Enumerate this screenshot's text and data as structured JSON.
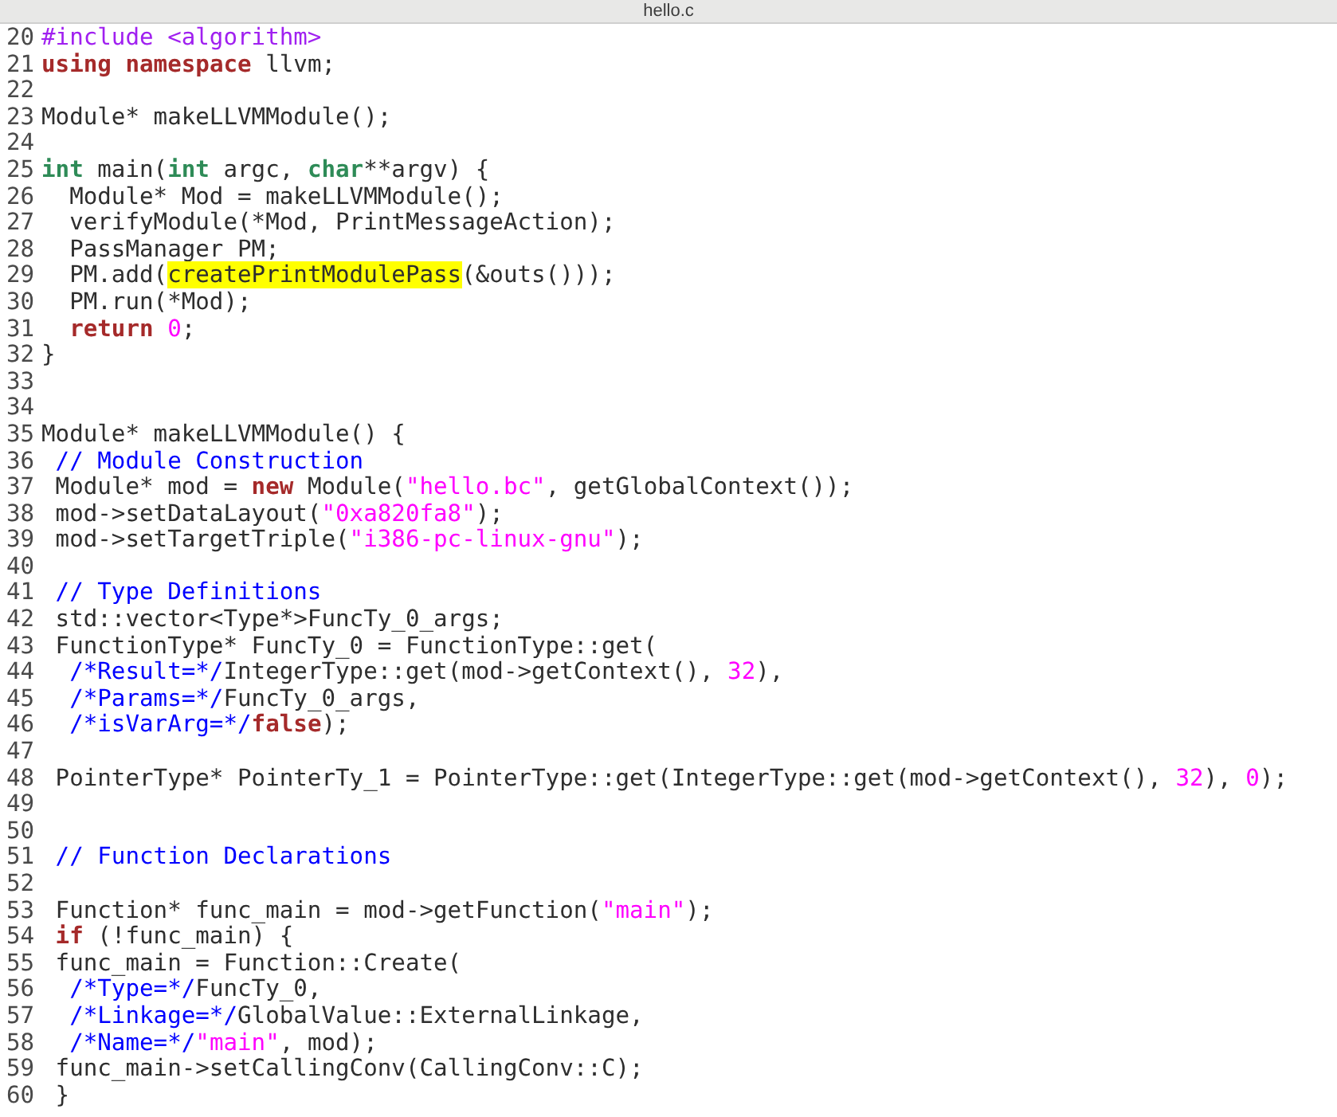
{
  "window": {
    "title": "hello.c"
  },
  "editor": {
    "lines": [
      {
        "number": "20",
        "tokens": [
          {
            "kind": "preproc",
            "text": "#include <algorithm>"
          }
        ]
      },
      {
        "number": "21",
        "tokens": [
          {
            "kind": "keyword",
            "text": "using"
          },
          {
            "kind": "keyword",
            "text": " namespace"
          },
          {
            "kind": "plain",
            "text": " llvm;"
          }
        ]
      },
      {
        "number": "22"
      },
      {
        "number": "23",
        "tokens": [
          {
            "kind": "plain",
            "text": "Module* makeLLVMModule();"
          }
        ]
      },
      {
        "number": "24"
      },
      {
        "number": "25",
        "tokens": [
          {
            "kind": "type",
            "text": "int"
          },
          {
            "kind": "plain",
            "text": " main("
          },
          {
            "kind": "type",
            "text": "int"
          },
          {
            "kind": "plain",
            "text": " argc, "
          },
          {
            "kind": "type",
            "text": "char"
          },
          {
            "kind": "plain",
            "text": "**argv) {"
          }
        ]
      },
      {
        "number": "26",
        "tokens": [
          {
            "kind": "plain",
            "text": "  Module* Mod = makeLLVMModule();"
          }
        ]
      },
      {
        "number": "27",
        "tokens": [
          {
            "kind": "plain",
            "text": "  verifyModule(*Mod, PrintMessageAction);"
          }
        ]
      },
      {
        "number": "28",
        "tokens": [
          {
            "kind": "plain",
            "text": "  PassManager PM;"
          }
        ]
      },
      {
        "number": "29",
        "tokens": [
          {
            "kind": "plain",
            "text": "  PM.add("
          },
          {
            "kind": "match",
            "text": "createPrintModulePass"
          },
          {
            "kind": "plain",
            "text": "(&outs()));"
          }
        ]
      },
      {
        "number": "30",
        "tokens": [
          {
            "kind": "plain",
            "text": "  PM.run(*Mod);"
          }
        ]
      },
      {
        "number": "31",
        "tokens": [
          {
            "kind": "keyword",
            "text": "  return"
          },
          {
            "kind": "literal",
            "text": " 0"
          },
          {
            "kind": "plain",
            "text": ";"
          }
        ]
      },
      {
        "number": "32",
        "tokens": [
          {
            "kind": "plain",
            "text": "}"
          }
        ]
      },
      {
        "number": "33"
      },
      {
        "number": "34"
      },
      {
        "number": "35",
        "tokens": [
          {
            "kind": "plain",
            "text": "Module* makeLLVMModule() {"
          }
        ]
      },
      {
        "number": "36",
        "tokens": [
          {
            "kind": "comment",
            "text": " // Module Construction"
          }
        ]
      },
      {
        "number": "37",
        "tokens": [
          {
            "kind": "plain",
            "text": " Module* mod = "
          },
          {
            "kind": "keyword",
            "text": "new"
          },
          {
            "kind": "plain",
            "text": " Module("
          },
          {
            "kind": "literal",
            "text": "\"hello.bc\""
          },
          {
            "kind": "plain",
            "text": ", getGlobalContext());"
          }
        ]
      },
      {
        "number": "38",
        "tokens": [
          {
            "kind": "plain",
            "text": " mod->setDataLayout("
          },
          {
            "kind": "literal",
            "text": "\"0xa820fa8\""
          },
          {
            "kind": "plain",
            "text": ");"
          }
        ]
      },
      {
        "number": "39",
        "tokens": [
          {
            "kind": "plain",
            "text": " mod->setTargetTriple("
          },
          {
            "kind": "literal",
            "text": "\"i386-pc-linux-gnu\""
          },
          {
            "kind": "plain",
            "text": ");"
          }
        ]
      },
      {
        "number": "40"
      },
      {
        "number": "41",
        "tokens": [
          {
            "kind": "comment",
            "text": " // Type Definitions"
          }
        ]
      },
      {
        "number": "42",
        "tokens": [
          {
            "kind": "plain",
            "text": " std::vector<Type*>FuncTy_0_args;"
          }
        ]
      },
      {
        "number": "43",
        "tokens": [
          {
            "kind": "plain",
            "text": " FunctionType* FuncTy_0 = FunctionType::get("
          }
        ]
      },
      {
        "number": "44",
        "tokens": [
          {
            "kind": "comment",
            "text": "  /*Result=*/"
          },
          {
            "kind": "plain",
            "text": "IntegerType::get(mod->getContext(), "
          },
          {
            "kind": "literal",
            "text": "32"
          },
          {
            "kind": "plain",
            "text": "),"
          }
        ]
      },
      {
        "number": "45",
        "tokens": [
          {
            "kind": "comment",
            "text": "  /*Params=*/"
          },
          {
            "kind": "plain",
            "text": "FuncTy_0_args,"
          }
        ]
      },
      {
        "number": "46",
        "tokens": [
          {
            "kind": "comment",
            "text": "  /*isVarArg=*/"
          },
          {
            "kind": "keyword",
            "text": "false"
          },
          {
            "kind": "plain",
            "text": ");"
          }
        ]
      },
      {
        "number": "47"
      },
      {
        "number": "48",
        "tokens": [
          {
            "kind": "plain",
            "text": " PointerType* PointerTy_1 = PointerType::get(IntegerType::get(mod->getContext(), "
          },
          {
            "kind": "literal",
            "text": "32"
          },
          {
            "kind": "plain",
            "text": "), "
          },
          {
            "kind": "literal",
            "text": "0"
          },
          {
            "kind": "plain",
            "text": ");"
          }
        ]
      },
      {
        "number": "49"
      },
      {
        "number": "50"
      },
      {
        "number": "51",
        "tokens": [
          {
            "kind": "comment",
            "text": " // Function Declarations"
          }
        ]
      },
      {
        "number": "52"
      },
      {
        "number": "53",
        "tokens": [
          {
            "kind": "plain",
            "text": " Function* func_main = mod->getFunction("
          },
          {
            "kind": "literal",
            "text": "\"main\""
          },
          {
            "kind": "plain",
            "text": ");"
          }
        ]
      },
      {
        "number": "54",
        "tokens": [
          {
            "kind": "keyword",
            "text": " if"
          },
          {
            "kind": "plain",
            "text": " (!func_main) {"
          }
        ]
      },
      {
        "number": "55",
        "tokens": [
          {
            "kind": "plain",
            "text": " func_main = Function::Create("
          }
        ]
      },
      {
        "number": "56",
        "tokens": [
          {
            "kind": "comment",
            "text": "  /*Type=*/"
          },
          {
            "kind": "plain",
            "text": "FuncTy_0,"
          }
        ]
      },
      {
        "number": "57",
        "tokens": [
          {
            "kind": "comment",
            "text": "  /*Linkage=*/"
          },
          {
            "kind": "plain",
            "text": "GlobalValue::ExternalLinkage,"
          }
        ]
      },
      {
        "number": "58",
        "tokens": [
          {
            "kind": "comment",
            "text": "  /*Name=*/"
          },
          {
            "kind": "literal",
            "text": "\"main\""
          },
          {
            "kind": "plain",
            "text": ", mod);"
          }
        ]
      },
      {
        "number": "59",
        "tokens": [
          {
            "kind": "plain",
            "text": " func_main->setCallingConv(CallingConv::C);"
          }
        ]
      },
      {
        "number": "60",
        "tokens": [
          {
            "kind": "plain",
            "text": " }"
          }
        ]
      }
    ]
  }
}
